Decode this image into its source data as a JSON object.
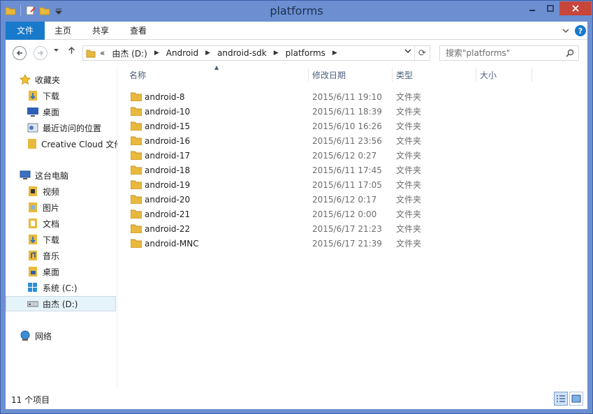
{
  "window": {
    "title": "platforms"
  },
  "ribbon": {
    "tabs": [
      "文件",
      "主页",
      "共享",
      "查看"
    ]
  },
  "address": {
    "overflow": "«",
    "crumbs": [
      "由杰 (D:)",
      "Android",
      "android-sdk",
      "platforms"
    ]
  },
  "search": {
    "placeholder": "搜索\"platforms\""
  },
  "nav": {
    "favorites": {
      "label": "收藏夹",
      "items": [
        "下载",
        "桌面",
        "最近访问的位置",
        "Creative Cloud 文件"
      ]
    },
    "pc": {
      "label": "这台电脑",
      "items": [
        "视频",
        "图片",
        "文档",
        "下载",
        "音乐",
        "桌面",
        "系统 (C:)",
        "由杰 (D:)"
      ]
    },
    "network": {
      "label": "网络"
    }
  },
  "columns": {
    "name": "名称",
    "date": "修改日期",
    "type": "类型",
    "size": "大小"
  },
  "files": [
    {
      "name": "android-8",
      "date": "2015/6/11 19:10",
      "type": "文件夹"
    },
    {
      "name": "android-10",
      "date": "2015/6/11 18:39",
      "type": "文件夹"
    },
    {
      "name": "android-15",
      "date": "2015/6/10 16:26",
      "type": "文件夹"
    },
    {
      "name": "android-16",
      "date": "2015/6/11 23:56",
      "type": "文件夹"
    },
    {
      "name": "android-17",
      "date": "2015/6/12 0:27",
      "type": "文件夹"
    },
    {
      "name": "android-18",
      "date": "2015/6/11 17:45",
      "type": "文件夹"
    },
    {
      "name": "android-19",
      "date": "2015/6/11 17:05",
      "type": "文件夹"
    },
    {
      "name": "android-20",
      "date": "2015/6/12 0:17",
      "type": "文件夹"
    },
    {
      "name": "android-21",
      "date": "2015/6/12 0:00",
      "type": "文件夹"
    },
    {
      "name": "android-22",
      "date": "2015/6/17 21:23",
      "type": "文件夹"
    },
    {
      "name": "android-MNC",
      "date": "2015/6/17 21:39",
      "type": "文件夹"
    }
  ],
  "status": {
    "count": "11 个项目"
  },
  "colors": {
    "accent": "#1979ca",
    "titlebar": "#6b8fd0",
    "close": "#c7463b",
    "folder": "#e8b93c"
  }
}
